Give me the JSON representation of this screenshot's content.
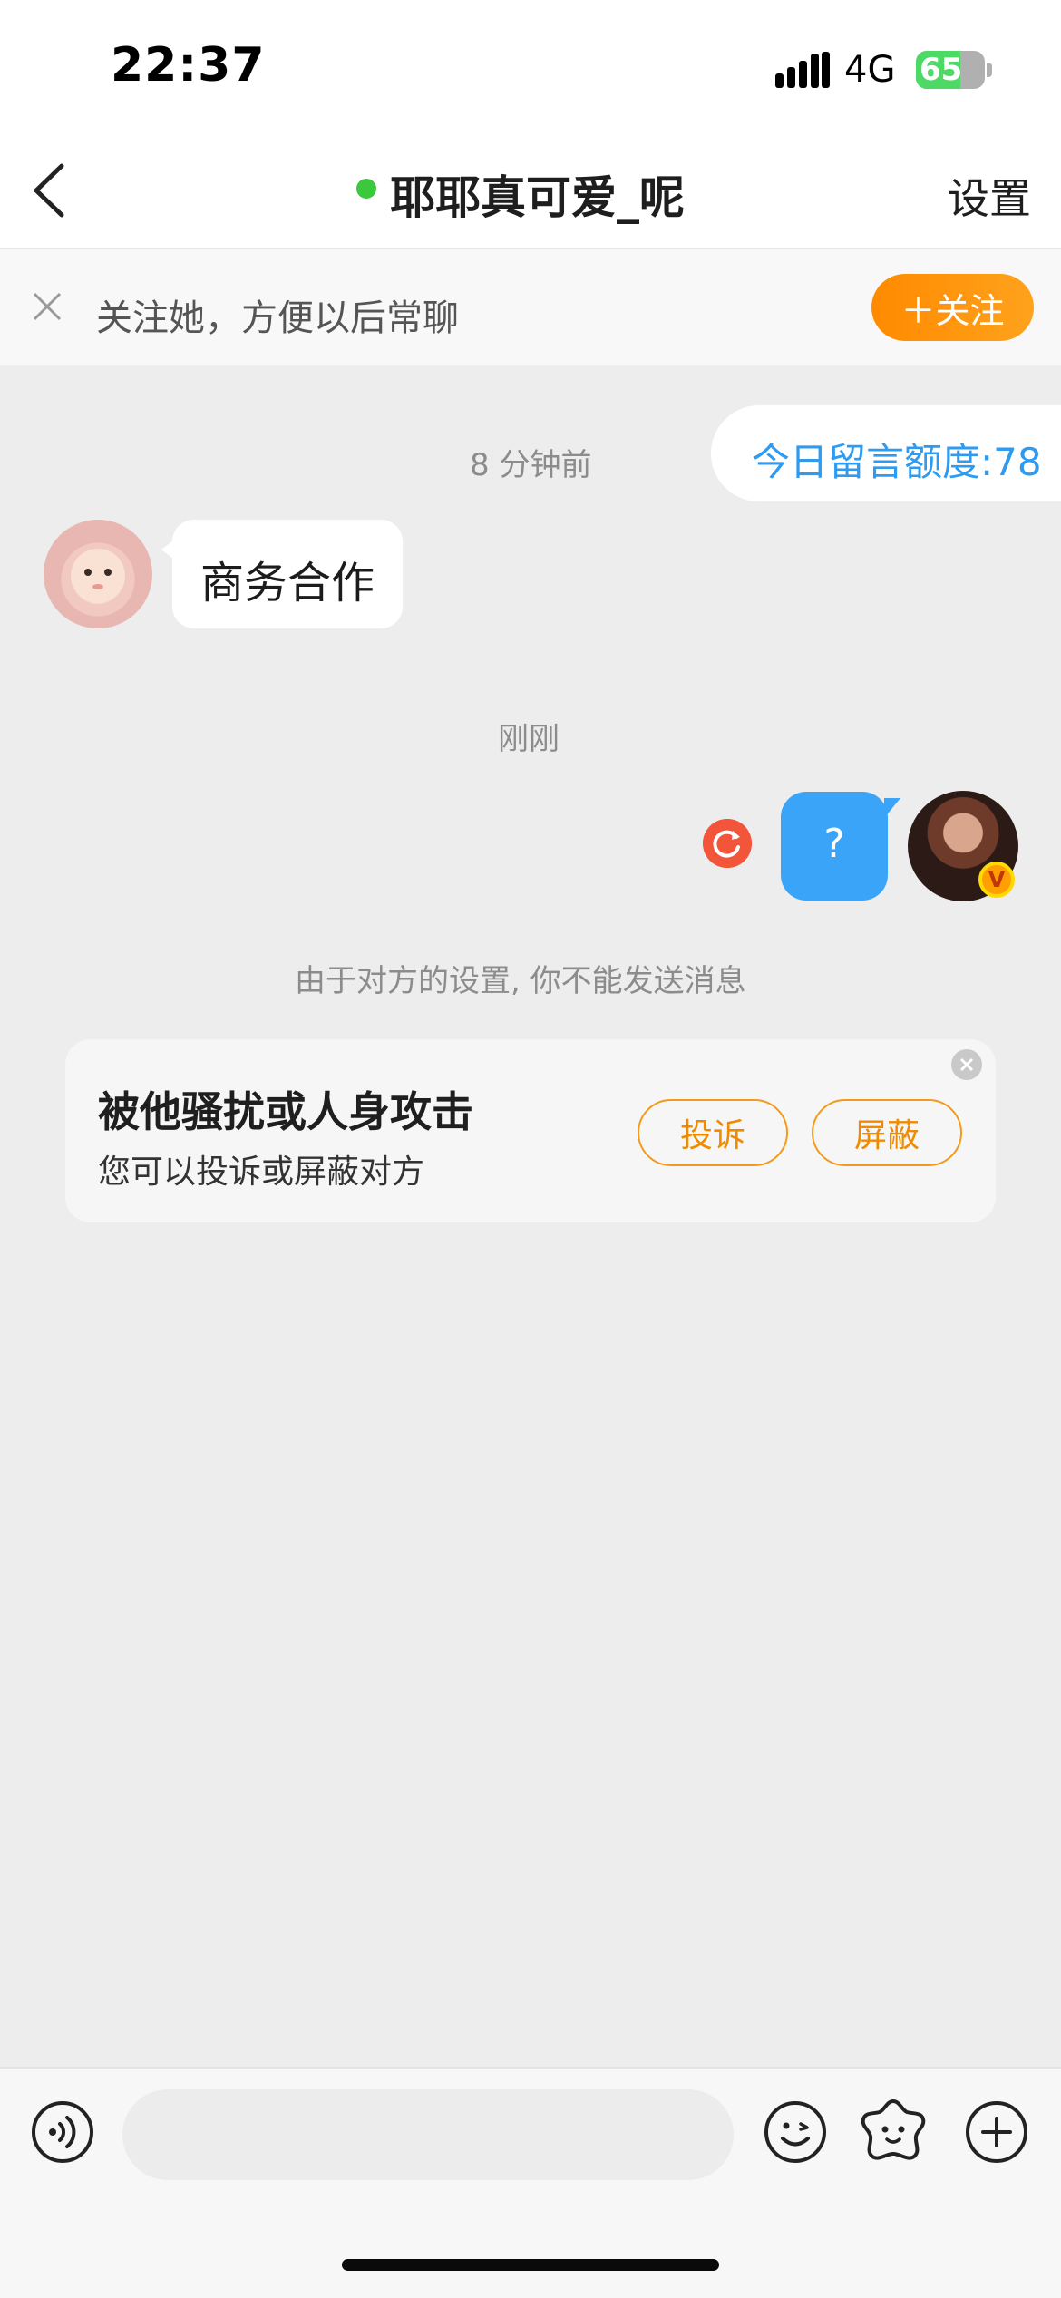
{
  "status_bar": {
    "time": "22:37",
    "network": "4G",
    "battery_percent": "65",
    "battery_level": 0.65,
    "icons": [
      "signal-bars-icon",
      "charging-bolt-icon"
    ]
  },
  "nav": {
    "title": "耶耶真可爱_呢",
    "online": true,
    "settings_label": "设置",
    "back_icon": "chevron-left-icon"
  },
  "follow_bar": {
    "text": "关注她，方便以后常聊",
    "button_label": "＋关注",
    "close_icon": "close-icon"
  },
  "chat": {
    "quota_label": "今日留言额度:78",
    "messages": [
      {
        "time": "8 分钟前",
        "side": "left",
        "text": "商务合作"
      },
      {
        "time": "刚刚",
        "side": "right",
        "text": "?",
        "status": "failed-retry"
      }
    ],
    "notice": "由于对方的设置, 你不能发送消息",
    "vip_badge": "V"
  },
  "harass_card": {
    "title": "被他骚扰或人身攻击",
    "subtitle": "您可以投诉或屏蔽对方",
    "complain_label": "投诉",
    "block_label": "屏蔽"
  },
  "input_bar": {
    "placeholder": "",
    "icons": [
      "voice-icon",
      "emoji-icon",
      "sticker-icon",
      "plus-icon"
    ]
  },
  "colors": {
    "accent_orange": "#ff8a00",
    "accent_blue": "#3aa4f9",
    "online_green": "#3cc83c",
    "retry_red": "#f2553a"
  }
}
